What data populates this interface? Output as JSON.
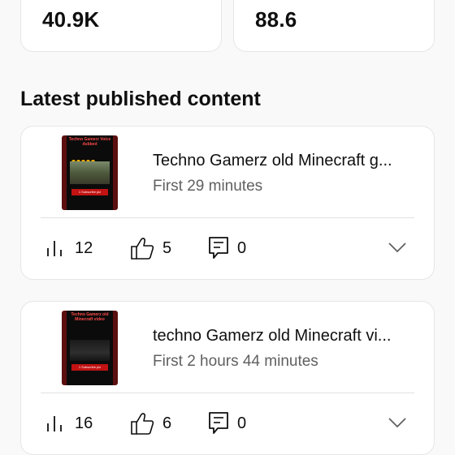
{
  "stats": {
    "left_value": "40.9K",
    "right_value": "88.6"
  },
  "section": {
    "title": "Latest published content"
  },
  "items": [
    {
      "title": "Techno Gamerz old Minecraft g...",
      "subtitle": "First 29 minutes",
      "views": "12",
      "likes": "5",
      "comments": "0",
      "thumb_top_text": "Techno Gamerz Voice dubbed",
      "thumb_bottom_text": "1 Subscribe plz"
    },
    {
      "title": "techno Gamerz old Minecraft vi...",
      "subtitle": "First 2 hours 44 minutes",
      "views": "16",
      "likes": "6",
      "comments": "0",
      "thumb_top_text": "Techno Gamerz old Minecraft video",
      "thumb_bottom_text": "1 Subscribe plz"
    }
  ],
  "icons": {
    "views": "bar-chart-icon",
    "likes": "thumbs-up-icon",
    "comments": "comment-icon",
    "expand": "chevron-down-icon"
  },
  "colors": {
    "background": "#f9f9f9",
    "card": "#ffffff",
    "text": "#0f0f0f",
    "secondary_text": "#606060",
    "thumbnail_red": "#c21212"
  }
}
